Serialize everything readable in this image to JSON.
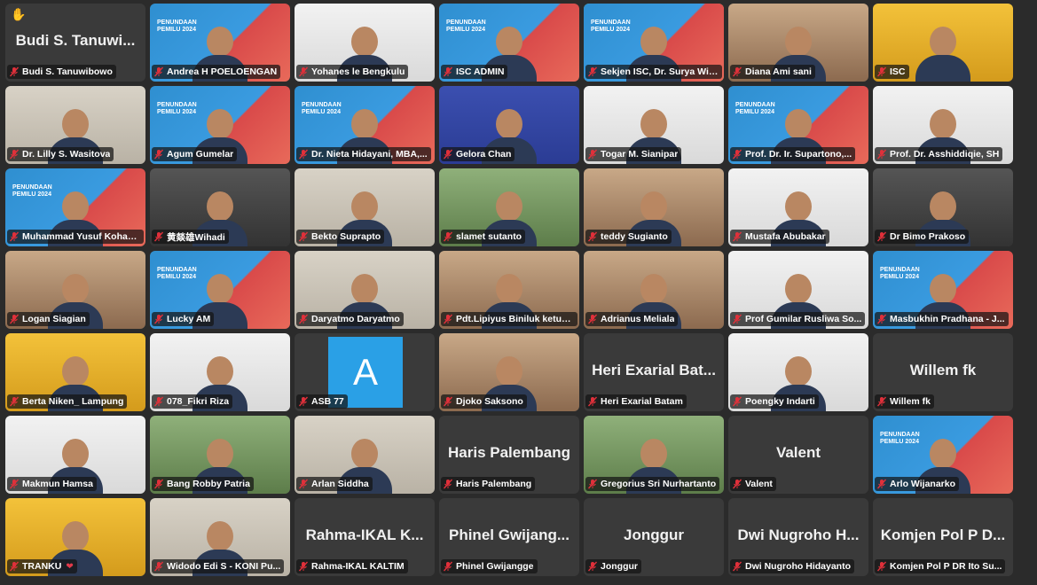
{
  "participants": [
    {
      "name": "Budi S. Tanuwibowo",
      "display": "Budi S. Tanuwi...",
      "video": false,
      "hand": true
    },
    {
      "name": "Andrea H POELOENGAN",
      "video": true,
      "bg": "event"
    },
    {
      "name": "Yohanes le Bengkulu",
      "video": true,
      "bg": "white"
    },
    {
      "name": "ISC  ADMIN",
      "video": true,
      "bg": "event"
    },
    {
      "name": "Sekjen ISC, Dr. Surya Wira...",
      "video": true,
      "bg": "event",
      "speaking": true
    },
    {
      "name": "Diana Ami sani",
      "video": true,
      "bg": "warm"
    },
    {
      "name": "ISC",
      "video": true,
      "bg": "yellow"
    },
    {
      "name": "Dr. Lilly S. Wasitova",
      "video": true,
      "bg": "room"
    },
    {
      "name": "Agum Gumelar",
      "video": true,
      "bg": "event"
    },
    {
      "name": "Dr. Nieta Hidayani, MBA,...",
      "video": true,
      "bg": "event"
    },
    {
      "name": "Gelora Chan",
      "video": true,
      "bg": "blue"
    },
    {
      "name": "Togar M. Sianipar",
      "video": true,
      "bg": "white"
    },
    {
      "name": "Prof. Dr. Ir. Supartono,...",
      "video": true,
      "bg": "event"
    },
    {
      "name": "Prof. Dr. Asshiddiqie, SH",
      "video": true,
      "bg": "white"
    },
    {
      "name": "Muhammad Yusuf Kohar L...",
      "video": true,
      "bg": "event"
    },
    {
      "name": "黄燚雄Wihadi",
      "video": true,
      "bg": "dark"
    },
    {
      "name": "Bekto Suprapto",
      "video": true,
      "bg": "room"
    },
    {
      "name": "slamet sutanto",
      "video": true,
      "bg": "green"
    },
    {
      "name": "teddy Sugianto",
      "video": true,
      "bg": "warm"
    },
    {
      "name": "Mustafa Abubakar",
      "video": true,
      "bg": "white"
    },
    {
      "name": "Dr Bimo Prakoso",
      "video": true,
      "bg": "dark"
    },
    {
      "name": "Logan Siagian",
      "video": true,
      "bg": "warm"
    },
    {
      "name": "Lucky AM",
      "video": true,
      "bg": "event"
    },
    {
      "name": "Daryatmo Daryatmo",
      "video": true,
      "bg": "room"
    },
    {
      "name": "Pdt.Lipiyus Biniluk ketua...",
      "video": true,
      "bg": "warm"
    },
    {
      "name": "Adrianus Meliala",
      "video": true,
      "bg": "warm"
    },
    {
      "name": "Prof Gumilar Rusliwa So...",
      "video": true,
      "bg": "white"
    },
    {
      "name": "Masbukhin Pradhana - J...",
      "video": true,
      "bg": "event"
    },
    {
      "name": "Berta Niken_ Lampung",
      "video": true,
      "bg": "yellow"
    },
    {
      "name": "078_Fikri Riza",
      "video": true,
      "bg": "white"
    },
    {
      "name": "ASB 77",
      "video": false,
      "avatar": "A"
    },
    {
      "name": "Djoko Saksono",
      "video": true,
      "bg": "warm"
    },
    {
      "name": "Heri Exarial Batam",
      "display": "Heri Exarial Bat...",
      "video": false
    },
    {
      "name": "Poengky Indarti",
      "video": true,
      "bg": "white"
    },
    {
      "name": "Willem fk",
      "display": "Willem fk",
      "video": false
    },
    {
      "name": "Makmun Hamsa",
      "video": true,
      "bg": "white"
    },
    {
      "name": "Bang Robby Patria",
      "video": true,
      "bg": "green"
    },
    {
      "name": "Arlan Siddha",
      "video": true,
      "bg": "room"
    },
    {
      "name": "Haris Palembang",
      "display": "Haris Palembang",
      "video": false
    },
    {
      "name": "Gregorius Sri Nurhartanto",
      "video": true,
      "bg": "green"
    },
    {
      "name": "Valent",
      "display": "Valent",
      "video": false
    },
    {
      "name": "Arlo Wijanarko",
      "video": true,
      "bg": "event"
    },
    {
      "name": "TRANKU",
      "video": true,
      "bg": "yellow",
      "heart": true
    },
    {
      "name": "Widodo Edi S - KONI Pu...",
      "video": true,
      "bg": "room"
    },
    {
      "name": "Rahma-IKAL KALTIM",
      "display": "Rahma-IKAL K...",
      "video": false
    },
    {
      "name": "Phinel Gwijangge",
      "display": "Phinel Gwijang...",
      "video": false
    },
    {
      "name": "Jonggur",
      "display": "Jonggur",
      "video": false
    },
    {
      "name": "Dwi Nugroho Hidayanto",
      "display": "Dwi Nugroho H...",
      "video": false
    },
    {
      "name": "Komjen Pol P DR Ito Su...",
      "display": "Komjen Pol P D...",
      "video": false
    }
  ],
  "event_banner": {
    "line1": "PENUNDAAN",
    "line2": "PEMILU 2024"
  },
  "colors": {
    "muted_mic": "#e0303a",
    "speaking_border": "#7fd36a",
    "tile_bg": "#3a3a3a"
  }
}
